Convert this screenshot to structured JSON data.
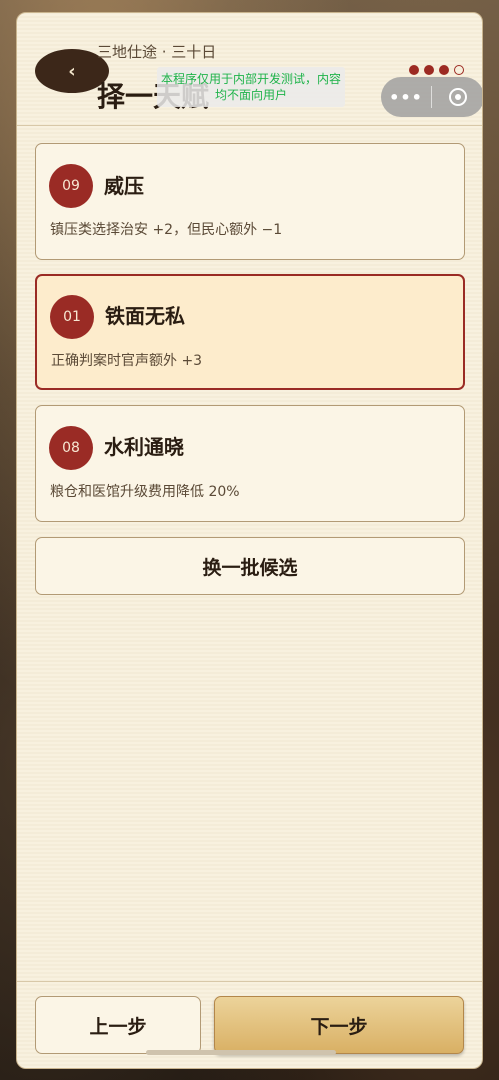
{
  "header": {
    "subtitle": "三地仕途 · 三十日",
    "title": "择一天赋",
    "back_label": "‹",
    "dev_notice": "本程序仅用于内部开发测试，内容均不面向用户",
    "progress_dots": {
      "filled": 3,
      "total": 4
    },
    "capsule_more": "•••"
  },
  "talents": [
    {
      "number": "09",
      "name": "威压",
      "desc": "镇压类选择治安 +2，但民心额外 −1",
      "selected": false
    },
    {
      "number": "01",
      "name": "铁面无私",
      "desc": "正确判案时官声额外 +3",
      "selected": true
    },
    {
      "number": "08",
      "name": "水利通晓",
      "desc": "粮仓和医馆升级费用降低 20%",
      "selected": false
    }
  ],
  "reroll_label": "换一批候选",
  "footer": {
    "prev_label": "上一步",
    "next_label": "下一步"
  },
  "colors": {
    "accent": "#9a2b25",
    "panel_bg": "#f8f1df",
    "next_button": "#d9b064"
  }
}
